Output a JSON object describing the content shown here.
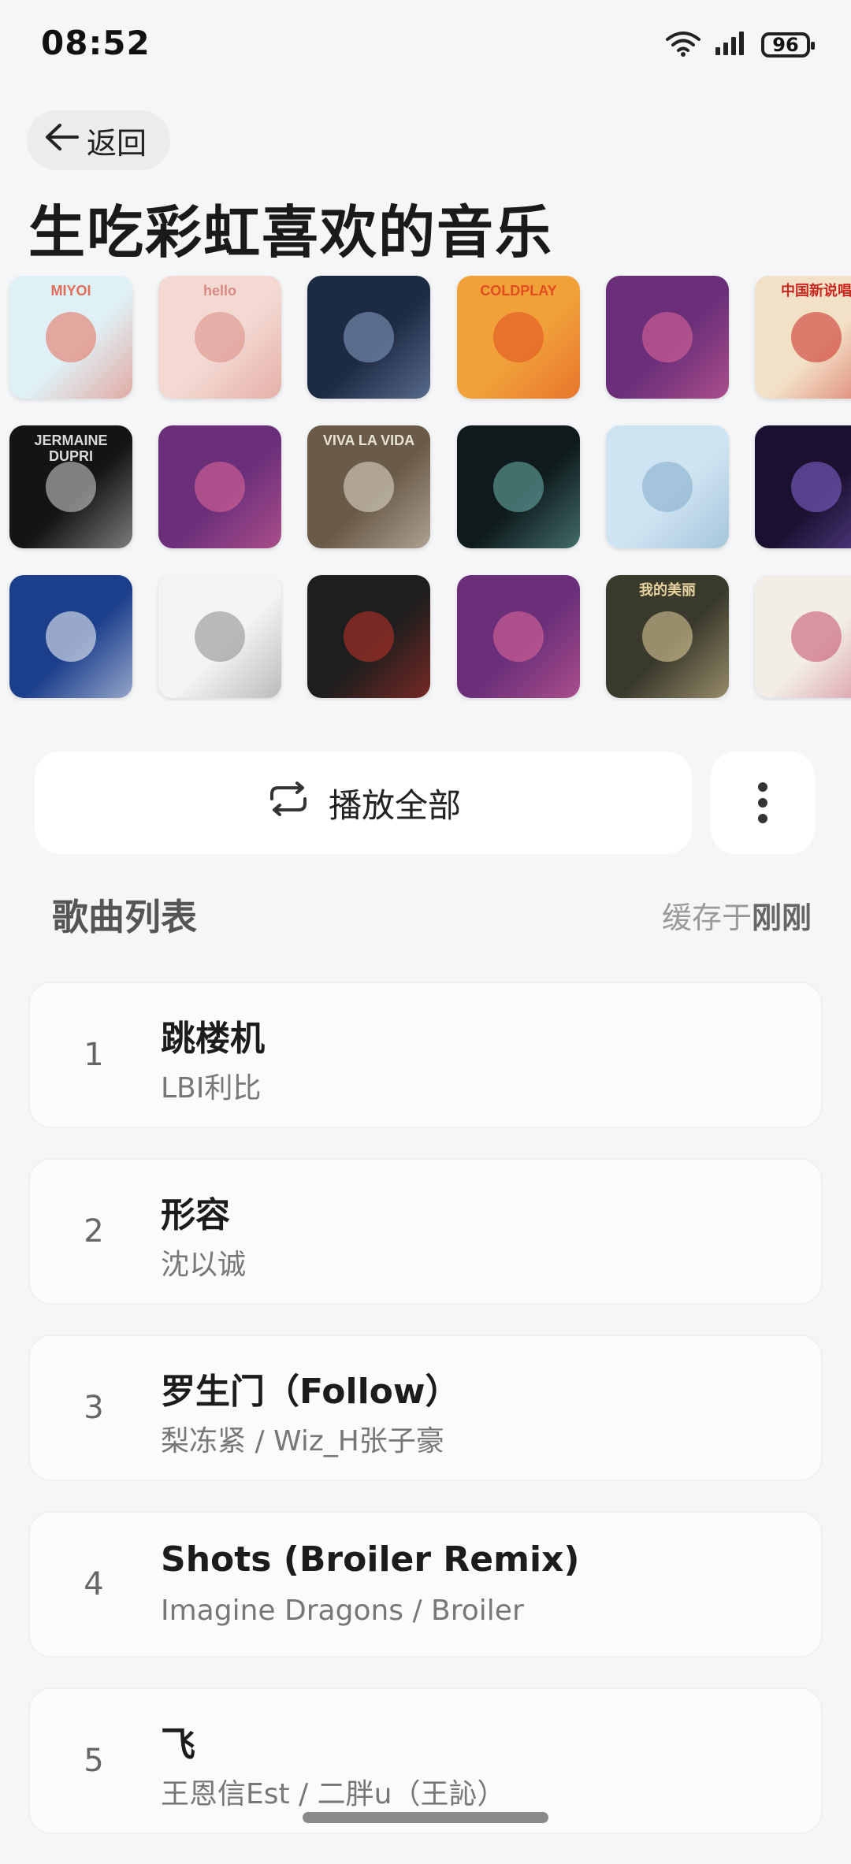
{
  "status": {
    "time": "08:52",
    "battery": "96"
  },
  "nav": {
    "back_label": "返回"
  },
  "playlist": {
    "title": "生吃彩虹喜欢的音乐"
  },
  "covers": [
    {
      "label": "MIYOI",
      "bg": "#dff1f6",
      "fg": "#e36b5a"
    },
    {
      "label": "hello",
      "bg": "#f3d9d2",
      "fg": "#d98a84"
    },
    {
      "label": "",
      "bg": "#1d2a44",
      "fg": "#8aa3c9"
    },
    {
      "label": "COLDPLAY",
      "bg": "#f1a13a",
      "fg": "#e04e20"
    },
    {
      "label": "",
      "bg": "#6b2f7a",
      "fg": "#e46a9a"
    },
    {
      "label": "中国新说唱",
      "bg": "#f3e1c7",
      "fg": "#c8261f"
    },
    {
      "label": "JERMAINE DUPRI",
      "bg": "#141414",
      "fg": "#d9d9d9"
    },
    {
      "label": "",
      "bg": "#6b2f7a",
      "fg": "#e46a9a"
    },
    {
      "label": "VIVA LA VIDA",
      "bg": "#6a5a48",
      "fg": "#e8e2d4"
    },
    {
      "label": "",
      "bg": "#0f1a1c",
      "fg": "#6fb6b0"
    },
    {
      "label": "",
      "bg": "#cfe4f2",
      "fg": "#7fa9c8"
    },
    {
      "label": "",
      "bg": "#1a1030",
      "fg": "#8a6ad8"
    },
    {
      "label": "",
      "bg": "#1c3f8c",
      "fg": "#ffffff"
    },
    {
      "label": "",
      "bg": "#f4f4f4",
      "fg": "#888888"
    },
    {
      "label": "",
      "bg": "#1e1e1e",
      "fg": "#c4332a"
    },
    {
      "label": "",
      "bg": "#6b2f7a",
      "fg": "#e46a9a"
    },
    {
      "label": "我的美丽",
      "bg": "#3a3a2c",
      "fg": "#e8d3a0"
    },
    {
      "label": "",
      "bg": "#f2ede6",
      "fg": "#c24a6c"
    }
  ],
  "actions": {
    "play_all": "播放全部",
    "more_icon": "more-vertical-icon"
  },
  "section": {
    "title": "歌曲列表",
    "cache_prefix": "缓存于",
    "cache_time": "刚刚"
  },
  "songs": [
    {
      "num": "1",
      "title": "跳楼机",
      "artist": "LBI利比"
    },
    {
      "num": "2",
      "title": "形容",
      "artist": "沈以诚"
    },
    {
      "num": "3",
      "title": "罗生门（Follow）",
      "artist": "梨冻紧 / Wiz_H张子豪"
    },
    {
      "num": "4",
      "title": "Shots (Broiler Remix)",
      "artist": "Imagine Dragons / Broiler"
    },
    {
      "num": "5",
      "title": "飞",
      "artist": "王恩信Est / 二胖u（王訫）"
    }
  ]
}
